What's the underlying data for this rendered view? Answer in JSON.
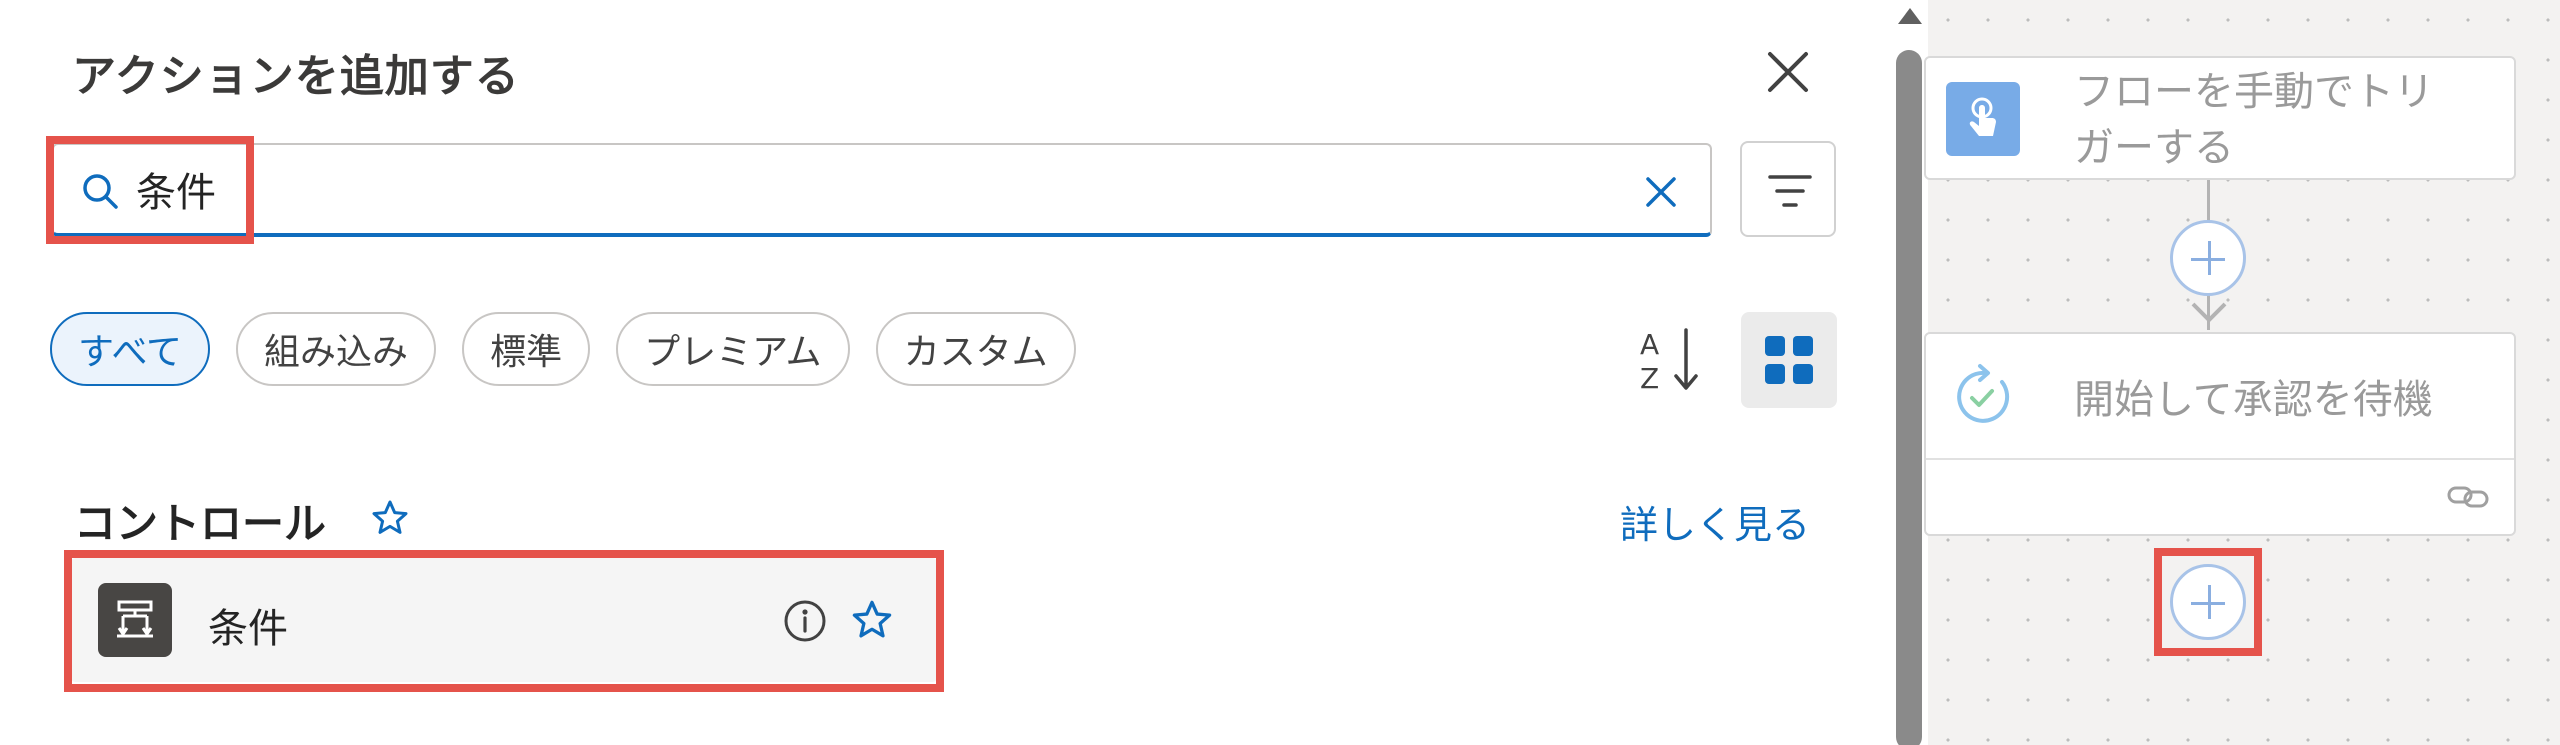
{
  "panel": {
    "title": "アクションを追加する",
    "search": {
      "value": "条件",
      "placeholder": ""
    },
    "filters": [
      "すべて",
      "組み込み",
      "標準",
      "プレミアム",
      "カスタム"
    ],
    "active_filter": "すべて",
    "section": {
      "title": "コントロール",
      "more_link": "詳しく見る",
      "items": [
        {
          "label": "条件",
          "icon": "condition-icon"
        }
      ]
    }
  },
  "canvas": {
    "nodes": [
      {
        "title_line1": "フローを手動でトリ",
        "title_line2": "ガーする",
        "icon": "touch-trigger-icon",
        "icon_color": "#4b8fe0"
      },
      {
        "title": "開始して承認を待機",
        "icon": "approval-icon",
        "icon_color": "#7ab6e6"
      }
    ]
  },
  "colors": {
    "accent": "#0f6cbd",
    "highlight": "#e5534b",
    "canvas_bg": "#f3f2f1"
  }
}
